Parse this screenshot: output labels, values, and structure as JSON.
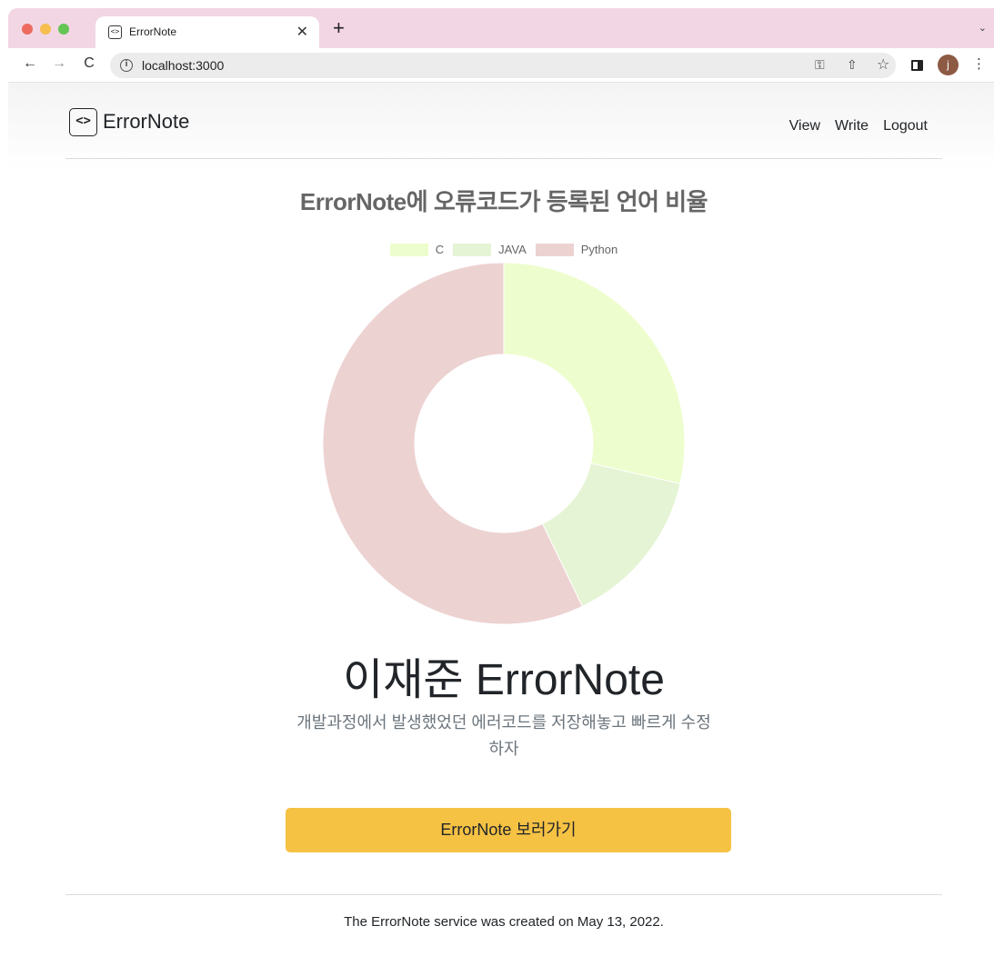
{
  "browser": {
    "tab_title": "ErrorNote",
    "tab_favicon_glyph": "<>",
    "tab_close_glyph": "✕",
    "new_tab_glyph": "+",
    "tabstrip_menu_glyph": "⌄",
    "url": "localhost:3000",
    "info_glyph": "i",
    "avatar_initial": "j",
    "icons": {
      "back": "←",
      "forward": "→",
      "reload": "C",
      "key": "⚿",
      "share": "⇧",
      "star": "☆",
      "kebab": "⋮"
    },
    "colors": {
      "tabstrip": "#f2d6e4"
    }
  },
  "header": {
    "brand_glyph": "<>",
    "brand_name": "ErrorNote",
    "nav": [
      {
        "label": "View"
      },
      {
        "label": "Write"
      },
      {
        "label": "Logout"
      }
    ]
  },
  "chart_data": {
    "type": "pie",
    "variant": "doughnut",
    "title": "ErrorNote에 오류코드가 등록된 언어 비율",
    "categories": [
      "C",
      "JAVA",
      "Python"
    ],
    "values": [
      5,
      2.5,
      10
    ],
    "colors": [
      "#eefdcd",
      "#e5f4d4",
      "#edd2d2"
    ],
    "legend_position": "top",
    "grid": false
  },
  "hero": {
    "title": "이재준 ErrorNote",
    "subtitle": "개발과정에서 발생했었던 에러코드를 저장해놓고 빠르게 수정하자",
    "cta_label": "ErrorNote 보러가기",
    "cta_color": "#f6c244"
  },
  "footer": {
    "text": "The ErrorNote service was created on May 13, 2022."
  }
}
